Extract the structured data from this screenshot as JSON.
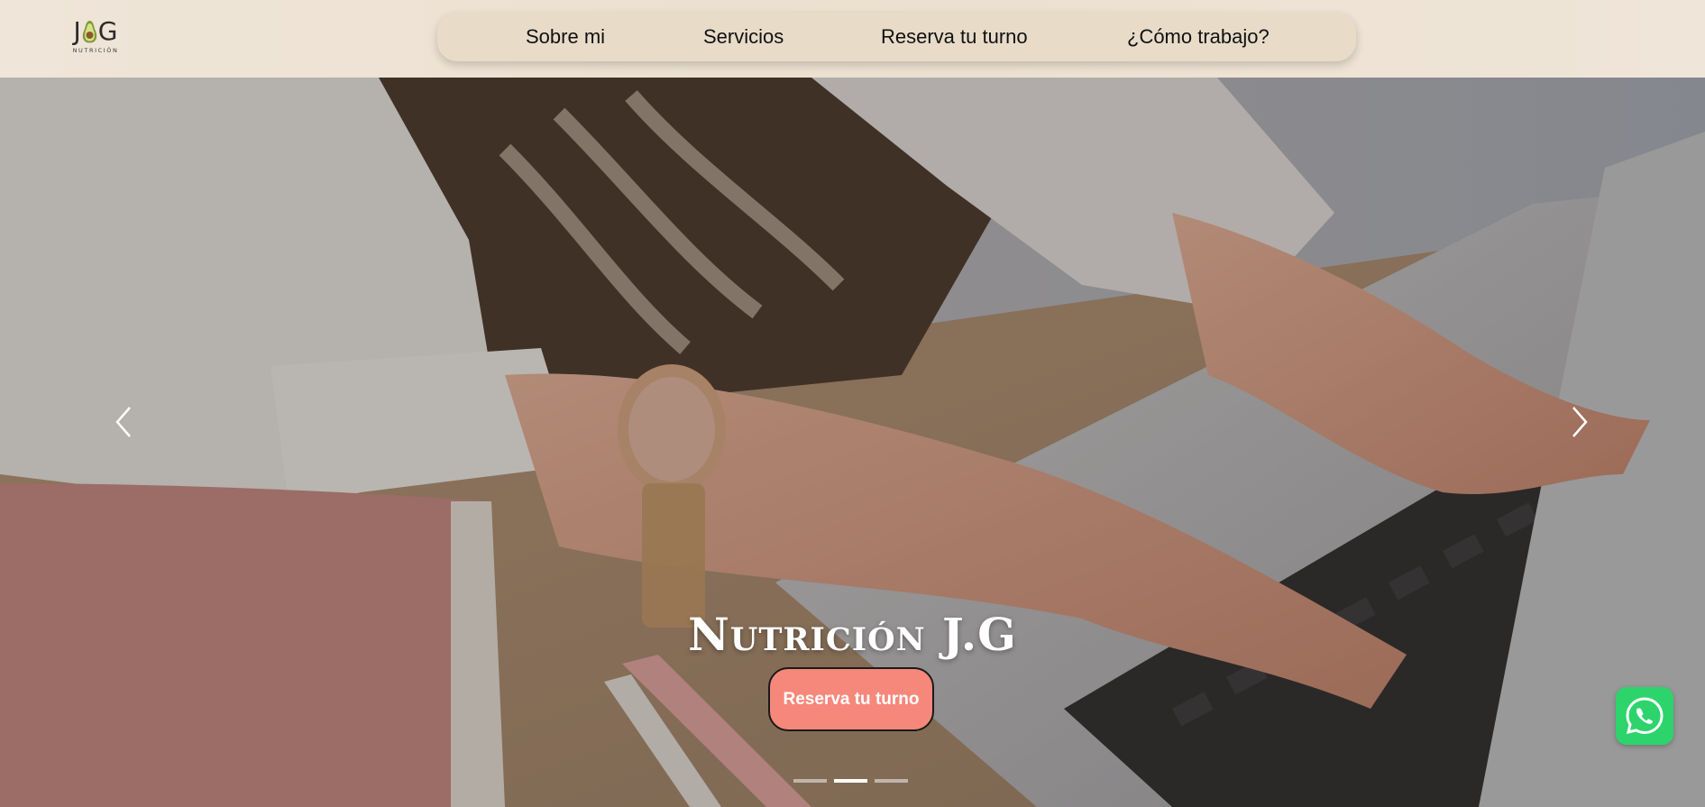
{
  "logo": {
    "letter_left": "J",
    "letter_right": "G",
    "subtitle": "NUTRICIÓN"
  },
  "nav": {
    "items": [
      {
        "label": "Sobre mi"
      },
      {
        "label": "Servicios"
      },
      {
        "label": "Reserva tu turno"
      },
      {
        "label": "¿Cómo trabajo?"
      }
    ]
  },
  "hero": {
    "title": "Nutrición J.G",
    "cta_label": "Reserva tu turno",
    "slides_count": 3,
    "active_slide": 2
  },
  "icons": {
    "prev": "chevron-left-icon",
    "next": "chevron-right-icon",
    "whatsapp": "whatsapp-icon",
    "logo_mark": "avocado-icon"
  },
  "colors": {
    "header_bg": "#ece0cf",
    "nav_pill": "#e8dcc9",
    "cta_bg": "#f5887a",
    "whatsapp": "#2cd46b"
  }
}
